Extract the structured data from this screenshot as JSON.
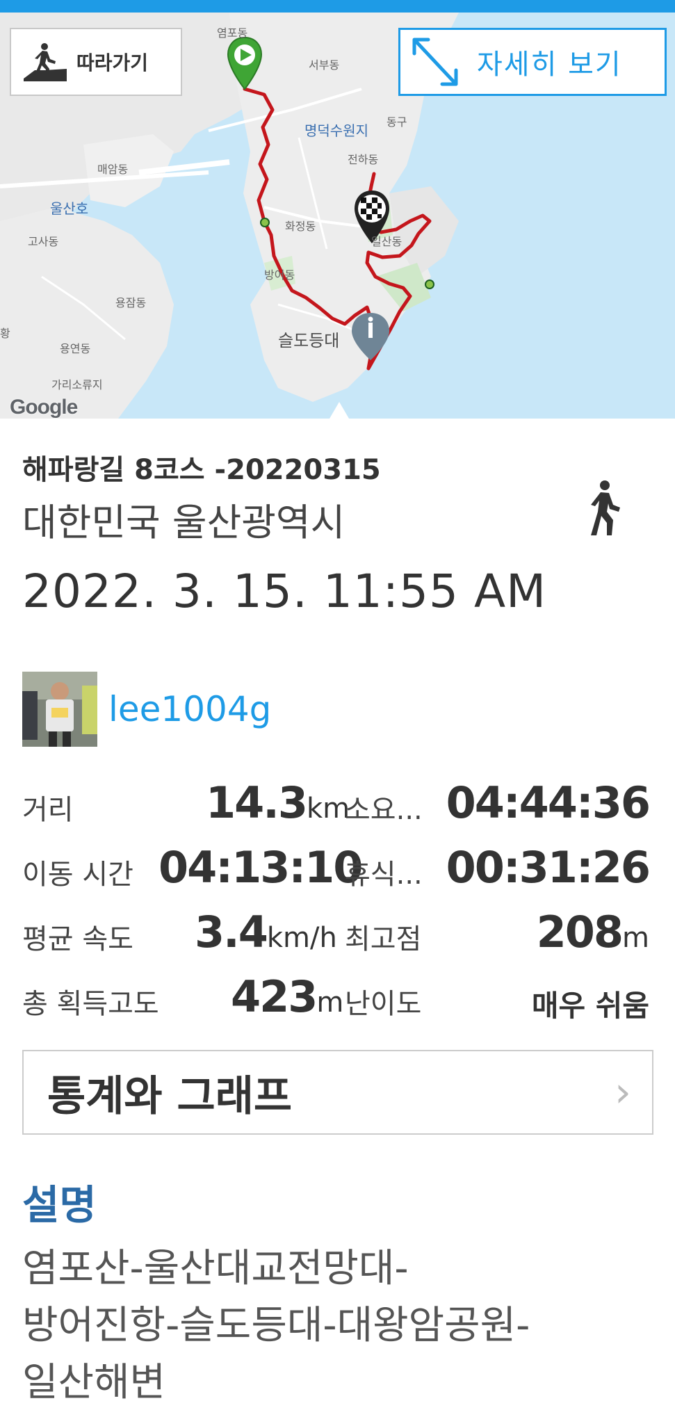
{
  "map": {
    "follow_label": "따라가기",
    "detail_label": "자세히 보기",
    "google_logo": "Google",
    "labels": {
      "yeompo": "염포동",
      "seobu": "서부동",
      "myeongdeok": "명덕수원지",
      "donggu": "동구",
      "jeonha": "전하동",
      "maeam": "매암동",
      "ulsanho": "울산호",
      "hwajeong": "화정동",
      "gosa": "고사동",
      "ilsan": "일산동",
      "bangeo": "방어동",
      "yongjam": "용잠동",
      "seuldo": "슬도등대",
      "yongyeon": "용연동",
      "gari": "가리소류지",
      "hwang": "황"
    }
  },
  "track": {
    "title": "해파랑길 8코스 -20220315",
    "location": "대한민국 울산광역시",
    "datetime": "2022. 3. 15. 11:55 AM",
    "activity_icon": "walking-icon"
  },
  "user": {
    "name": "lee1004g"
  },
  "stats": {
    "distance_label": "거리",
    "distance_value": "14.3",
    "distance_unit": "km",
    "duration_label": "소요...",
    "duration_value": "04:44:36",
    "moving_label": "이동 시간",
    "moving_value": "04:13:10",
    "rest_label": "휴식...",
    "rest_value": "00:31:26",
    "speed_label": "평균 속도",
    "speed_value": "3.4",
    "speed_unit": "km/h",
    "peak_label": "최고점",
    "peak_value": "208",
    "peak_unit": "m",
    "ascent_label": "총 획득고도",
    "ascent_value": "423",
    "ascent_unit": "m",
    "difficulty_label": "난이도",
    "difficulty_value": "매우 쉬움"
  },
  "graph_button": {
    "label": "통계와 그래프",
    "chevron": "›"
  },
  "description": {
    "title": "설명",
    "lines": [
      "염포산-울산대교전망대-",
      "방어진항-슬도등대-대왕암공원-",
      "일산해변"
    ]
  },
  "colors": {
    "accent": "#1e9be6",
    "route": "#c4161c",
    "desc_title": "#2b6aa6"
  }
}
